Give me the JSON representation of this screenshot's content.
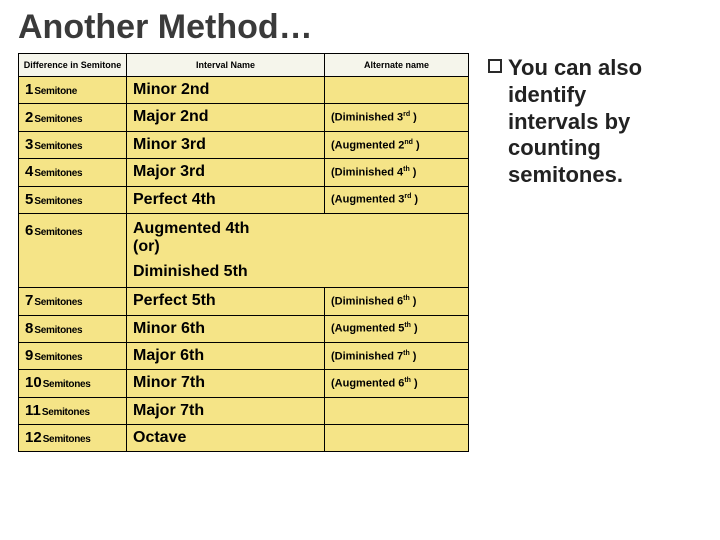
{
  "title": "Another Method…",
  "bullet": "You can also identify intervals by counting semitones.",
  "headers": {
    "c1": "Difference in Semitone",
    "c2": "Interval Name",
    "c3": "Alternate name"
  },
  "rows": {
    "r1": {
      "n": "1",
      "u": "Semitone",
      "name": "Minor 2nd",
      "alt_prefix": "",
      "alt_ord": ""
    },
    "r2": {
      "n": "2",
      "u": "Semitones",
      "name": "Major 2nd",
      "alt_prefix": "(Diminished 3",
      "alt_ord": "rd"
    },
    "r3": {
      "n": "3",
      "u": "Semitones",
      "name": "Minor 3rd",
      "alt_prefix": "(Augmented 2",
      "alt_ord": "nd"
    },
    "r4": {
      "n": "4",
      "u": "Semitones",
      "name": "Major 3rd",
      "alt_prefix": "(Diminished 4",
      "alt_ord": "th"
    },
    "r5": {
      "n": "5",
      "u": "Semitones",
      "name": "Perfect 4th",
      "alt_prefix": "(Augmented 3",
      "alt_ord": "rd"
    },
    "r6": {
      "n": "6",
      "u": "Semitones",
      "line1": "Augmented 4th",
      "line2": "(or)",
      "line3": "Diminished 5th"
    },
    "r7": {
      "n": "7",
      "u": "Semitones",
      "name": "Perfect 5th",
      "alt_prefix": "(Diminished 6",
      "alt_ord": "th"
    },
    "r8": {
      "n": "8",
      "u": "Semitones",
      "name": "Minor 6th",
      "alt_prefix": "(Augmented 5",
      "alt_ord": "th"
    },
    "r9": {
      "n": "9",
      "u": "Semitones",
      "name": "Major 6th",
      "alt_prefix": "(Diminished 7",
      "alt_ord": "th"
    },
    "r10": {
      "n": "10",
      "u": "Semitones",
      "name": "Minor 7th",
      "alt_prefix": "(Augmented 6",
      "alt_ord": "th"
    },
    "r11": {
      "n": "11",
      "u": "Semitones",
      "name": "Major 7th",
      "alt_prefix": "",
      "alt_ord": ""
    },
    "r12": {
      "n": "12",
      "u": "Semitones",
      "name": "Octave",
      "alt_prefix": "",
      "alt_ord": ""
    }
  }
}
